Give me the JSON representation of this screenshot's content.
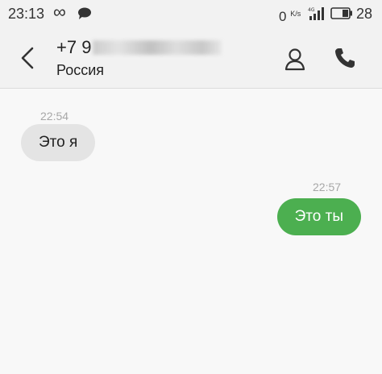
{
  "status_bar": {
    "time": "23:13",
    "infinity_icon": "infinity-icon",
    "chat_icon": "chat-bubble-icon",
    "net_speed_value": "0",
    "net_speed_unit": "K/s",
    "signal_icon": "signal-4g-icon",
    "battery_icon": "battery-icon",
    "battery_level": "28"
  },
  "header": {
    "phone_prefix": "+7 9",
    "country": "Россия",
    "back_icon": "chevron-left-icon",
    "contact_icon": "person-icon",
    "call_icon": "phone-icon"
  },
  "messages": [
    {
      "direction": "incoming",
      "time": "22:54",
      "text": "Это я"
    },
    {
      "direction": "outgoing",
      "time": "22:57",
      "text": "Это ты"
    }
  ],
  "colors": {
    "outgoing_bubble": "#4caf50",
    "incoming_bubble": "#e4e4e4",
    "header_bg": "#f2f2f2",
    "background": "#f8f8f8"
  }
}
